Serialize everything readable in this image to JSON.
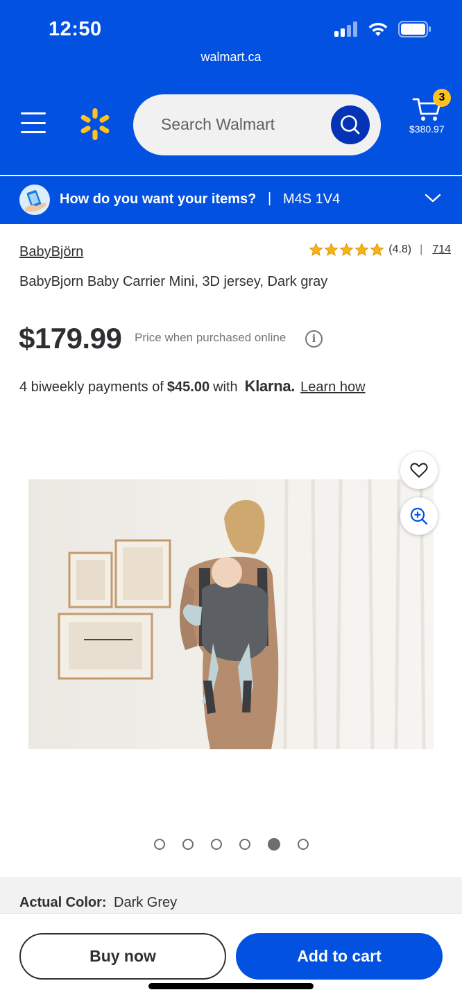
{
  "status": {
    "time": "12:50"
  },
  "browser": {
    "url": "walmart.ca"
  },
  "header": {
    "menu_icon": "hamburger-menu-icon",
    "logo_icon": "walmart-spark-icon",
    "search_placeholder": "Search Walmart",
    "search_icon": "search-icon",
    "cart": {
      "count": "3",
      "total": "$380.97",
      "icon": "cart-icon"
    }
  },
  "fulfillment": {
    "question": "How do you want your items?",
    "separator": "|",
    "postal_code": "M4S 1V4",
    "icon": "chevron-down-icon"
  },
  "product": {
    "brand": "BabyBjörn",
    "rating_stars": 4.8,
    "rating_value": "(4.8)",
    "rating_separator": "|",
    "review_count": "714",
    "title": "BabyBjorn Baby Carrier Mini, 3D jersey, Dark gray",
    "price": "$179.99",
    "price_note": "Price when purchased online",
    "info_icon_glyph": "i",
    "installment_prefix": "4 biweekly payments of",
    "installment_amount": "$45.00",
    "installment_suffix": "with",
    "klarna_logo": "Klarna.",
    "learn_how": "Learn how"
  },
  "gallery": {
    "total_images": 6,
    "active_index": 4,
    "favorite_icon": "heart-icon",
    "zoom_icon": "zoom-in-icon"
  },
  "variant": {
    "label": "Actual Color:",
    "value": "Dark Grey"
  },
  "actions": {
    "buy_now": "Buy now",
    "add_to_cart": "Add to cart"
  },
  "colors": {
    "brand_blue": "#0351e0",
    "search_blue": "#0433b6",
    "spark_yellow": "#ffc220",
    "star_yellow": "#f8b213"
  }
}
